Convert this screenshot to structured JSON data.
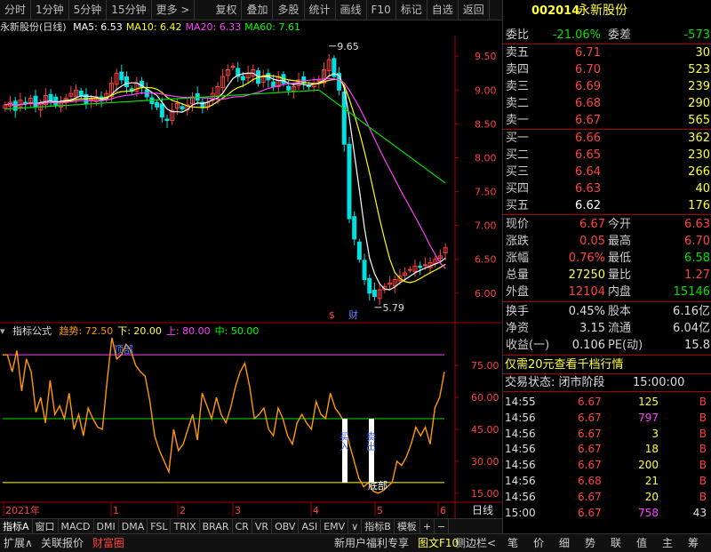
{
  "toolbar": {
    "left_items": [
      "分时",
      "1分钟",
      "5分钟",
      "15分钟",
      "更多 >"
    ],
    "right_items": [
      "复权",
      "叠加",
      "多股",
      "统计",
      "画线",
      "F10",
      "标记",
      "自选",
      "返回"
    ]
  },
  "kline": {
    "title": "永新股份(日线)",
    "ma": [
      {
        "label": "MA5: 6.53",
        "color": "#ffffff"
      },
      {
        "label": "MA10: 6.42",
        "color": "#ffff00"
      },
      {
        "label": "MA20: 6.33",
        "color": "#ff40ff"
      },
      {
        "label": "MA60: 7.61",
        "color": "#00ff00"
      }
    ],
    "high_label": "9.65",
    "low_label": "5.79",
    "marker_s": "$",
    "marker_cai": "财"
  },
  "indicator": {
    "name": "指标公式",
    "items": [
      {
        "label": "趋势: 72.50",
        "color": "#ff9900"
      },
      {
        "label": "下: 20.00",
        "color": "#ffff40"
      },
      {
        "label": "上: 80.00",
        "color": "#ff40ff"
      },
      {
        "label": "中: 50.00",
        "color": "#00ff00"
      }
    ],
    "top_label": "顶部",
    "bottom_label": "底部",
    "signal_a": "买入",
    "signal_b": "卖出"
  },
  "chart_data": {
    "type": "line",
    "price_axis": {
      "ylim": [
        5.8,
        9.7
      ],
      "ticks": [
        9.5,
        9.0,
        8.5,
        8.0,
        7.5,
        7.0,
        6.5,
        6.0
      ]
    },
    "indicator_axis": {
      "ylim": [
        12,
        88
      ],
      "ticks": [
        75.0,
        60.0,
        45.0,
        30.0,
        15.0
      ]
    },
    "x_labels": [
      "2021年",
      "1",
      "2",
      "3",
      "4",
      "5",
      "6"
    ],
    "series": [
      {
        "name": "趋势",
        "color": "#ff9900",
        "values": [
          80,
          80,
          72,
          82,
          63,
          78,
          72,
          53,
          60,
          48,
          68,
          52,
          56,
          50,
          62,
          45,
          52,
          42,
          55,
          50,
          46,
          45,
          68,
          88,
          78,
          80,
          85,
          82,
          75,
          72,
          70,
          58,
          42,
          35,
          30,
          25,
          45,
          35,
          38,
          45,
          52,
          40,
          62,
          56,
          50,
          60,
          52,
          48,
          55,
          65,
          72,
          76,
          65,
          50,
          52,
          55,
          45,
          42,
          55,
          50,
          42,
          38,
          48,
          52,
          48,
          45,
          58,
          52,
          50,
          62,
          55,
          52,
          48,
          38,
          30,
          22,
          18,
          20,
          16,
          15,
          16,
          18,
          20,
          30,
          28,
          32,
          38,
          46,
          42,
          46,
          38,
          55,
          60,
          72
        ]
      },
      {
        "name": "上",
        "values": [
          80
        ],
        "color": "#ff40ff"
      },
      {
        "name": "中",
        "values": [
          50
        ],
        "color": "#00ff00"
      },
      {
        "name": "下",
        "values": [
          20
        ],
        "color": "#ffff40"
      }
    ]
  },
  "quote": {
    "code": "002014",
    "name": "永新股份",
    "weibi_label": "委比",
    "weibi": "-21.06%",
    "weicha_label": "委差",
    "weicha": "-573",
    "asks": [
      {
        "label": "卖五",
        "price": "6.71",
        "vol": "30"
      },
      {
        "label": "卖四",
        "price": "6.70",
        "vol": "523"
      },
      {
        "label": "卖三",
        "price": "6.69",
        "vol": "239"
      },
      {
        "label": "卖二",
        "price": "6.68",
        "vol": "290"
      },
      {
        "label": "卖一",
        "price": "6.67",
        "vol": "565"
      }
    ],
    "bids": [
      {
        "label": "买一",
        "price": "6.66",
        "vol": "362"
      },
      {
        "label": "买二",
        "price": "6.65",
        "vol": "230"
      },
      {
        "label": "买三",
        "price": "6.64",
        "vol": "266"
      },
      {
        "label": "买四",
        "price": "6.63",
        "vol": "40"
      },
      {
        "label": "买五",
        "price": "6.62",
        "vol": "176"
      }
    ],
    "stats1": [
      {
        "l1": "现价",
        "v1": "6.67",
        "c1": "#ff4040",
        "l2": "今开",
        "v2": "6.63",
        "c2": "#ff4040"
      },
      {
        "l1": "涨跌",
        "v1": "0.05",
        "c1": "#ff4040",
        "l2": "最高",
        "v2": "6.70",
        "c2": "#ff4040"
      },
      {
        "l1": "涨幅",
        "v1": "0.76%",
        "c1": "#ff4040",
        "l2": "最低",
        "v2": "6.58",
        "c2": "#00e000"
      },
      {
        "l1": "总量",
        "v1": "27250",
        "c1": "#ffff40",
        "l2": "量比",
        "v2": "1.27",
        "c2": "#ff4040"
      },
      {
        "l1": "外盘",
        "v1": "12104",
        "c1": "#ff4040",
        "l2": "内盘",
        "v2": "15146",
        "c2": "#00e000"
      }
    ],
    "stats2": [
      {
        "l1": "换手",
        "v1": "0.45%",
        "l2": "股本",
        "v2": "6.16亿"
      },
      {
        "l1": "净资",
        "v1": "3.15",
        "l2": "流通",
        "v2": "6.04亿"
      },
      {
        "l1": "收益(一)",
        "v1": "0.106",
        "l2": "PE(动)",
        "v2": "15.8"
      }
    ],
    "promo": "仅需20元查看千档行情",
    "status_label": "交易状态: 闭市阶段",
    "status_time": "15:00:00"
  },
  "ticks": [
    {
      "time": "14:55",
      "price": "6.67",
      "vol": "125",
      "vcolor": "#ffff40",
      "side": "B"
    },
    {
      "time": "14:56",
      "price": "6.67",
      "vol": "797",
      "vcolor": "#ff40ff",
      "side": "B"
    },
    {
      "time": "14:56",
      "price": "6.67",
      "vol": "3",
      "vcolor": "#ffff40",
      "side": "B"
    },
    {
      "time": "14:56",
      "price": "6.67",
      "vol": "18",
      "vcolor": "#ffff40",
      "side": "B"
    },
    {
      "time": "14:56",
      "price": "6.67",
      "vol": "200",
      "vcolor": "#ffff40",
      "side": "B"
    },
    {
      "time": "14:56",
      "price": "6.68",
      "vol": "21",
      "vcolor": "#ffff40",
      "side": "B"
    },
    {
      "time": "14:56",
      "price": "6.67",
      "vol": "20",
      "vcolor": "#ffff40",
      "side": "B"
    },
    {
      "time": "15:00",
      "price": "6.67",
      "vol": "758",
      "vcolor": "#ff40ff",
      "side": "43"
    }
  ],
  "bottom_tabs": [
    "指标A",
    "窗口",
    "MACD",
    "DMI",
    "DMA",
    "FSL",
    "TRIX",
    "BRAR",
    "CR",
    "VR",
    "OBV",
    "ASI",
    "EMV",
    "∨",
    "指标B",
    "模板",
    "+",
    "−"
  ],
  "period_label": "日线",
  "footer": {
    "left": [
      "扩展∧",
      "关联报价",
      "财富圈"
    ],
    "mid": [
      "新用户福利专享",
      "图文F10",
      "侧边栏<"
    ],
    "right": [
      "笔",
      "价",
      "细",
      "势",
      "联",
      "值",
      "主",
      "筹"
    ]
  }
}
